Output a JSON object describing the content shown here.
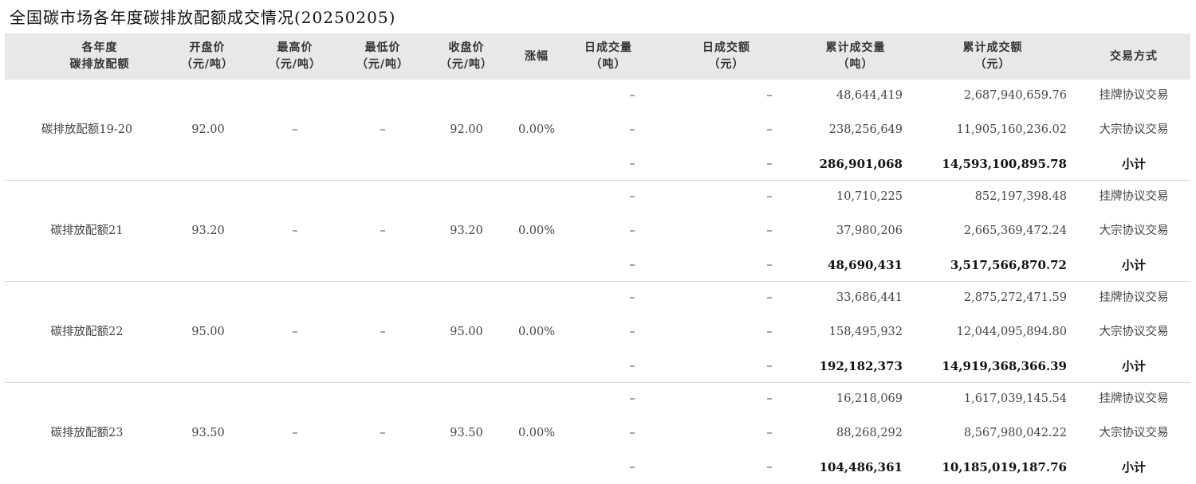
{
  "title": "全国碳市场各年度碳排放配额成交情况(20250205)",
  "headers": [
    {
      "l1": "各年度",
      "l2": "碳排放配额"
    },
    {
      "l1": "开盘价",
      "l2": "（元/吨）"
    },
    {
      "l1": "最高价",
      "l2": "（元/吨）"
    },
    {
      "l1": "最低价",
      "l2": "（元/吨）"
    },
    {
      "l1": "收盘价",
      "l2": "（元/吨）"
    },
    {
      "l1": "涨幅",
      "l2": ""
    },
    {
      "l1": "日成交量",
      "l2": "（吨）"
    },
    {
      "l1": "日成交额",
      "l2": "（元）"
    },
    {
      "l1": "累计成交量",
      "l2": "（吨）"
    },
    {
      "l1": "累计成交额",
      "l2": "（元）"
    },
    {
      "l1": "交易方式",
      "l2": ""
    }
  ],
  "groups": [
    {
      "name": "碳排放配额19-20",
      "open": "92.00",
      "high": "–",
      "low": "–",
      "close": "92.00",
      "change": "0.00%",
      "rows": [
        {
          "dvol": "–",
          "damt": "–",
          "cvol": "48,644,419",
          "camt": "2,687,940,659.76",
          "mode": "挂牌协议交易"
        },
        {
          "dvol": "–",
          "damt": "–",
          "cvol": "238,256,649",
          "camt": "11,905,160,236.02",
          "mode": "大宗协议交易"
        },
        {
          "dvol": "–",
          "damt": "–",
          "cvol": "286,901,068",
          "camt": "14,593,100,895.78",
          "mode": "小计"
        }
      ]
    },
    {
      "name": "碳排放配额21",
      "open": "93.20",
      "high": "–",
      "low": "–",
      "close": "93.20",
      "change": "0.00%",
      "rows": [
        {
          "dvol": "–",
          "damt": "–",
          "cvol": "10,710,225",
          "camt": "852,197,398.48",
          "mode": "挂牌协议交易"
        },
        {
          "dvol": "–",
          "damt": "–",
          "cvol": "37,980,206",
          "camt": "2,665,369,472.24",
          "mode": "大宗协议交易"
        },
        {
          "dvol": "–",
          "damt": "–",
          "cvol": "48,690,431",
          "camt": "3,517,566,870.72",
          "mode": "小计"
        }
      ]
    },
    {
      "name": "碳排放配额22",
      "open": "95.00",
      "high": "–",
      "low": "–",
      "close": "95.00",
      "change": "0.00%",
      "rows": [
        {
          "dvol": "–",
          "damt": "–",
          "cvol": "33,686,441",
          "camt": "2,875,272,471.59",
          "mode": "挂牌协议交易"
        },
        {
          "dvol": "–",
          "damt": "–",
          "cvol": "158,495,932",
          "camt": "12,044,095,894.80",
          "mode": "大宗协议交易"
        },
        {
          "dvol": "–",
          "damt": "–",
          "cvol": "192,182,373",
          "camt": "14,919,368,366.39",
          "mode": "小计"
        }
      ]
    },
    {
      "name": "碳排放配额23",
      "open": "93.50",
      "high": "–",
      "low": "–",
      "close": "93.50",
      "change": "0.00%",
      "rows": [
        {
          "dvol": "–",
          "damt": "–",
          "cvol": "16,218,069",
          "camt": "1,617,039,145.54",
          "mode": "挂牌协议交易"
        },
        {
          "dvol": "–",
          "damt": "–",
          "cvol": "88,268,292",
          "camt": "8,567,980,042.22",
          "mode": "大宗协议交易"
        },
        {
          "dvol": "–",
          "damt": "–",
          "cvol": "104,486,361",
          "camt": "10,185,019,187.76",
          "mode": "小计"
        }
      ]
    }
  ]
}
